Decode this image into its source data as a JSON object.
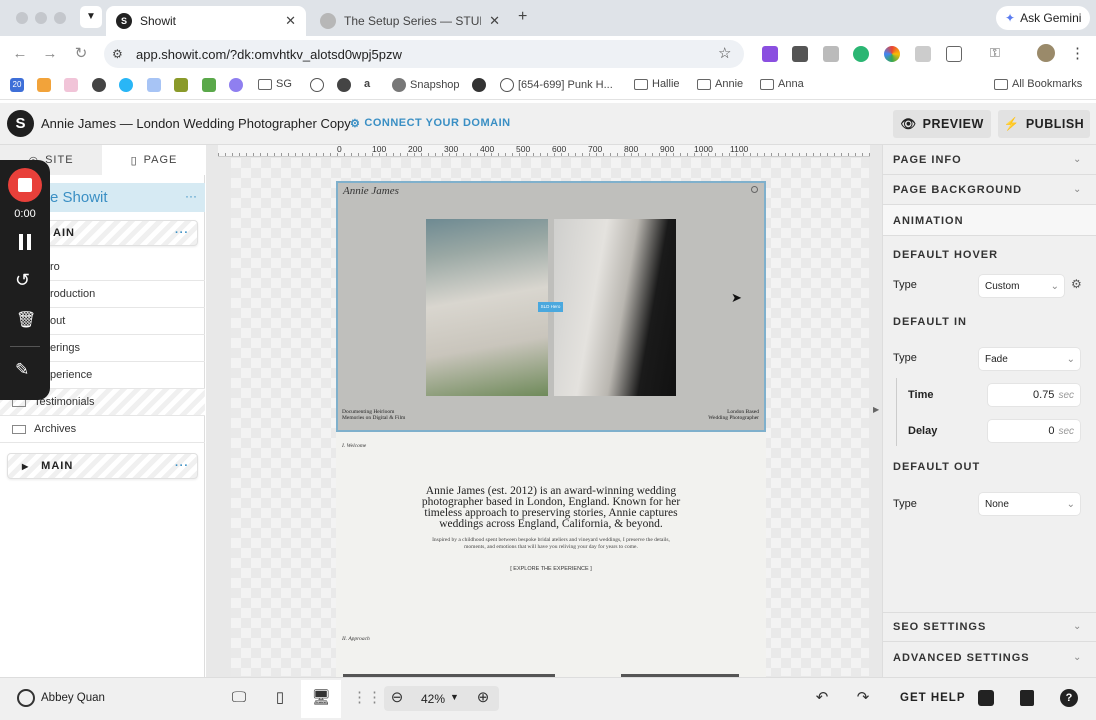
{
  "browser": {
    "tabs": [
      {
        "title": "Showit",
        "active": true
      },
      {
        "title": "The Setup Series — STUDIO (",
        "active": false
      }
    ],
    "new_tab": "+",
    "gemini_label": "Ask Gemini",
    "url": "app.showit.com/?dk:omvhtkv_alotsd0wpj5pzw",
    "bookmarks": [
      "SG",
      "Snapshop",
      "[654-699] Punk H...",
      "Hallie",
      "Annie",
      "Anna"
    ],
    "bookmark_badge": "20",
    "all_bookmarks": "All Bookmarks"
  },
  "app": {
    "logo": "S",
    "site_title": "Annie James — London Wedding Photographer Copy",
    "connect_domain": "CONNECT YOUR DOMAIN",
    "preview": "PREVIEW",
    "publish": "PUBLISH"
  },
  "left_panel": {
    "tabs": [
      "SITE",
      "PAGE"
    ],
    "page_name": "e Showit",
    "more": "···",
    "section_main_top": "AIN",
    "items": [
      "ro",
      "roduction",
      "out",
      "erings",
      "perience",
      "Testimonials",
      "Archives"
    ],
    "section_main_bottom": "MAIN"
  },
  "recorder": {
    "time": "0:00"
  },
  "canvas": {
    "ruler": [
      "0",
      "100",
      "200",
      "300",
      "400",
      "500",
      "600",
      "700",
      "800",
      "900",
      "1000",
      "1100"
    ],
    "hero_logo": "Annie James",
    "hero_badge": "SLD Hero",
    "hero_left_caption": [
      "Documenting Heirloom",
      "Memories on Digital & Film"
    ],
    "hero_right_caption": [
      "London Based",
      "Wedding Photographer"
    ],
    "welcome_label": "I. Welcome",
    "intro": "Annie James (est. 2012) is an award-winning wedding photographer based in London, England. Known for her timeless approach to preserving stories, Annie captures weddings across England, California, & beyond.",
    "subtext": "Inspired by a childhood spent between bespoke bridal ateliers and vineyard weddings, I preserve the details, moments, and emotions that will have you reliving your day for years to come.",
    "cta": "[ EXPLORE THE EXPERIENCE ]",
    "approach_label": "II. Approach"
  },
  "right_panel": {
    "page_info": "PAGE INFO",
    "page_background": "PAGE BACKGROUND",
    "animation": "ANIMATION",
    "default_hover": "DEFAULT HOVER",
    "type_label": "Type",
    "hover_type": "Custom",
    "default_in": "DEFAULT IN",
    "in_type": "Fade",
    "time_label": "Time",
    "time_value": "0.75",
    "delay_label": "Delay",
    "delay_value": "0",
    "unit": "sec",
    "default_out": "DEFAULT OUT",
    "out_type": "None",
    "seo": "SEO SETTINGS",
    "advanced": "ADVANCED SETTINGS"
  },
  "bottom_bar": {
    "user": "Abbey Quan",
    "zoom": "42%",
    "get_help": "GET HELP"
  }
}
